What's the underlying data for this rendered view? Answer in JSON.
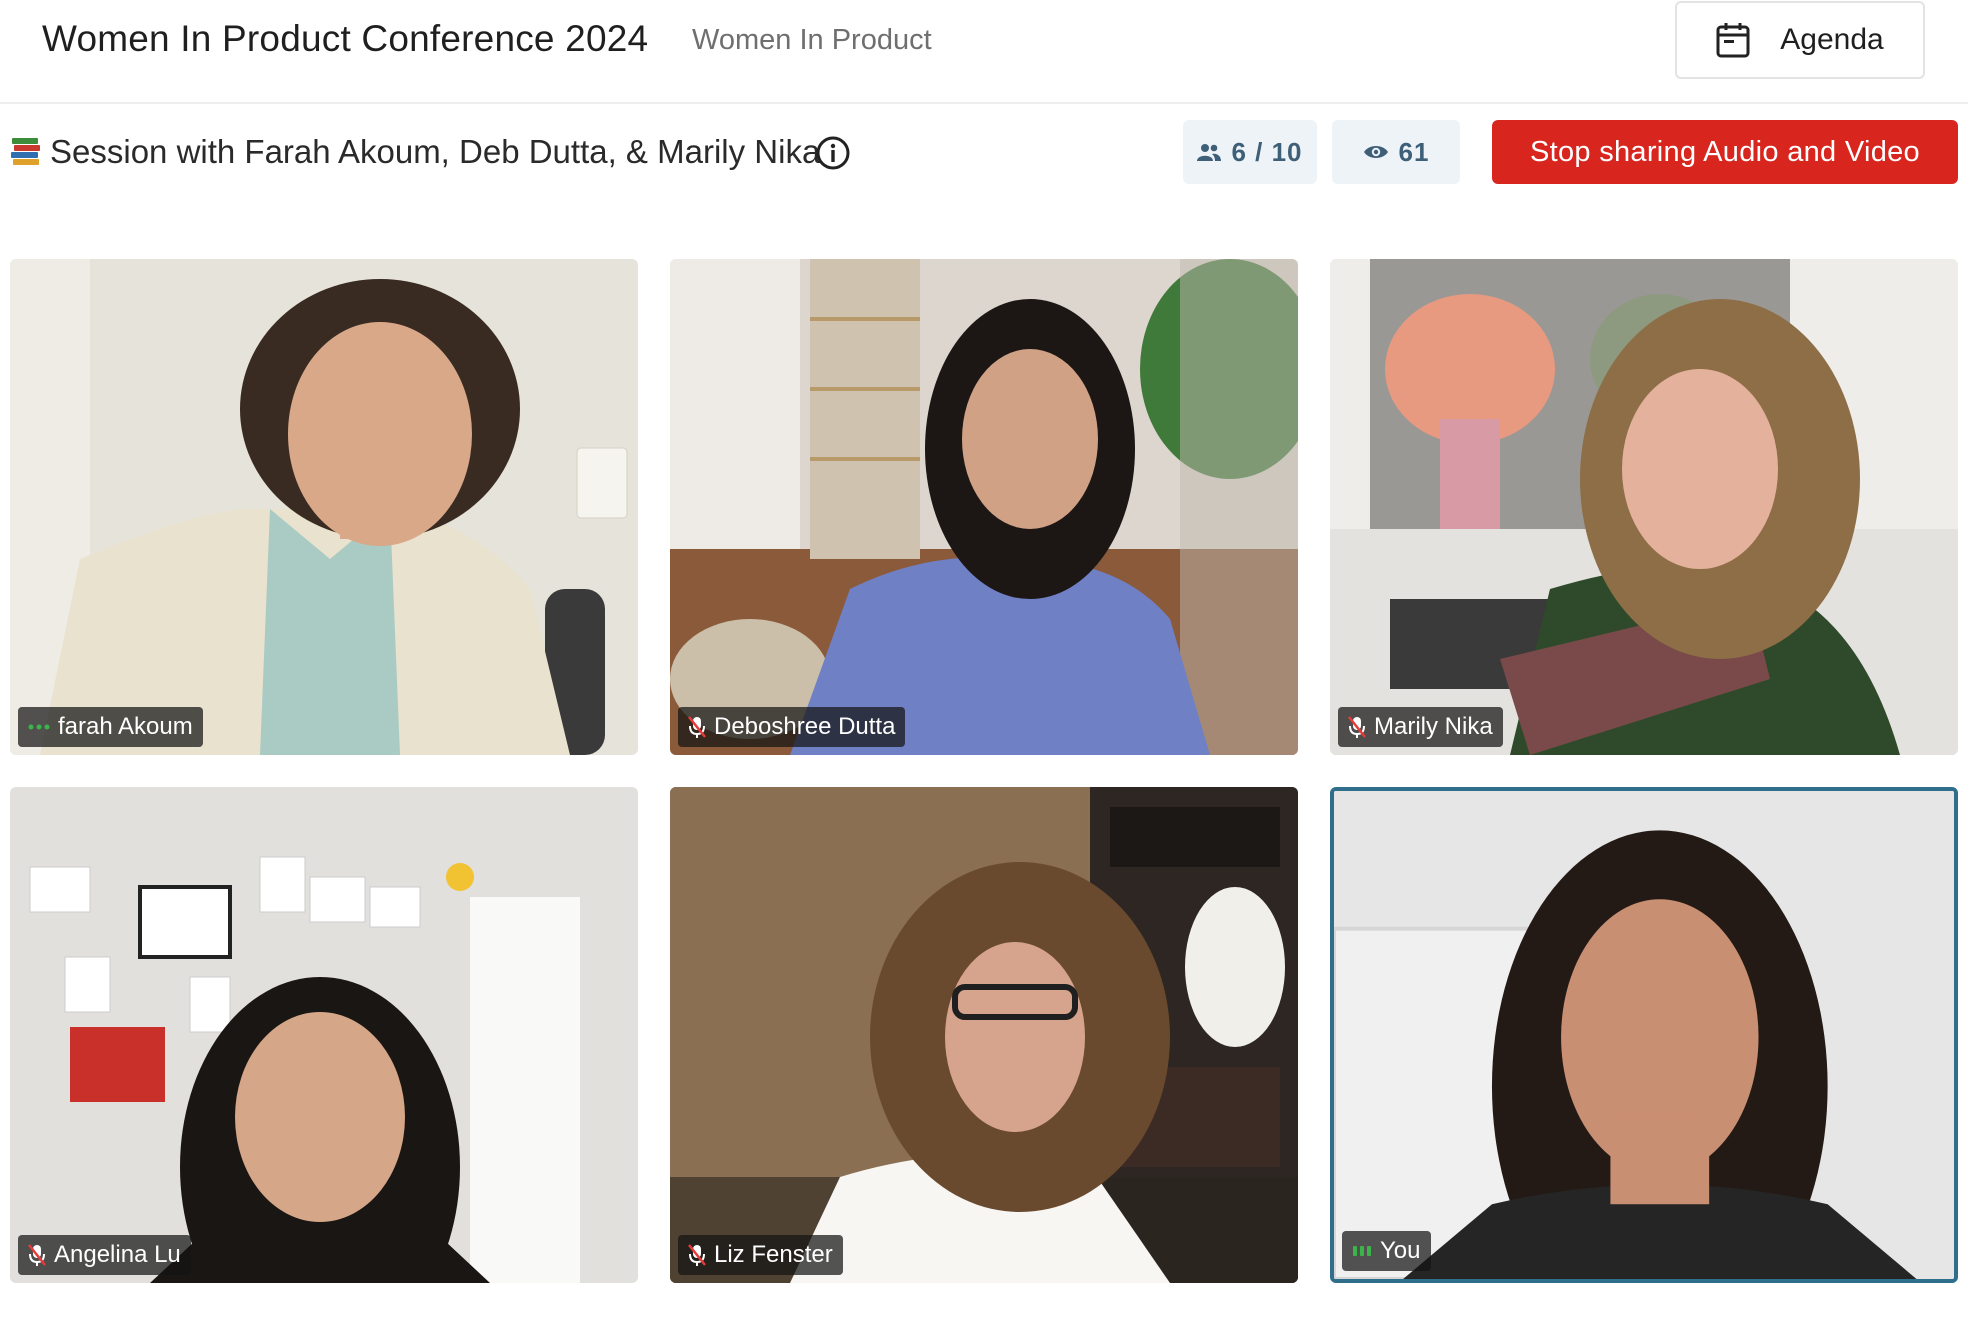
{
  "header": {
    "conference_title": "Women In Product Conference 2024",
    "organization": "Women In Product",
    "agenda_label": "Agenda",
    "agenda_icon": "calendar-icon"
  },
  "session": {
    "icon": "books-icon",
    "title": "Session with Farah Akoum, Deb Dutta, & Marily Nika",
    "participants_count": "6 / 10",
    "viewers_count": "61",
    "stop_sharing_label": "Stop sharing Audio and Video"
  },
  "colors": {
    "stop_button": "#d8251e",
    "pill_background": "#eef3f7",
    "pill_text": "#3e5f78",
    "active_tile_border": "#2f6f8c",
    "speaking_indicator": "#3bb54a"
  },
  "participants": [
    {
      "name": "farah Akoum",
      "status_icon": "speaking-dots-icon"
    },
    {
      "name": "Deboshree Dutta",
      "status_icon": "mic-muted-icon"
    },
    {
      "name": "Marily Nika",
      "status_icon": "mic-muted-icon"
    },
    {
      "name": "Angelina Lu",
      "status_icon": "mic-muted-icon"
    },
    {
      "name": "Liz Fenster",
      "status_icon": "mic-muted-icon"
    },
    {
      "name": "You",
      "status_icon": "audio-level-icon"
    }
  ]
}
